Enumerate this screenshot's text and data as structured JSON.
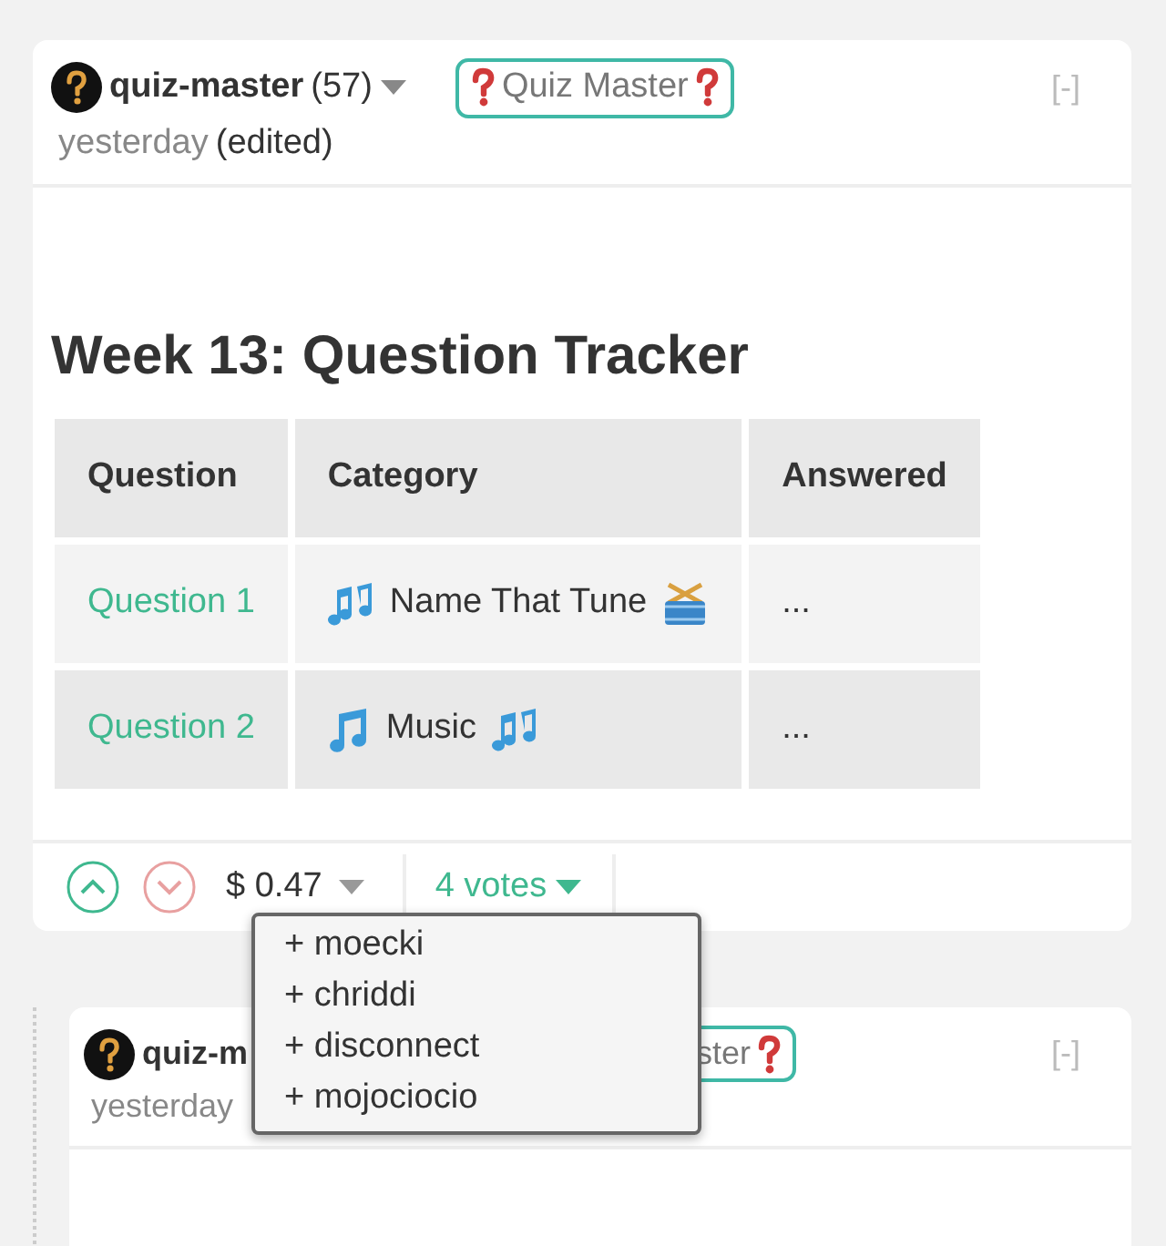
{
  "posts": [
    {
      "author": "quiz-master",
      "reputation": "(57)",
      "badge": "Quiz Master",
      "time": "yesterday",
      "edited": "(edited)",
      "collapse": "[-]",
      "title": "Week 13: Question Tracker",
      "table": {
        "columns": [
          "Question",
          "Category",
          "Answered"
        ],
        "rows": [
          {
            "question": "Question 1",
            "category": [
              {
                "kind": "notes"
              },
              {
                "kind": "text",
                "text": "Name That Tune"
              },
              {
                "kind": "drum"
              }
            ],
            "answered": "..."
          },
          {
            "question": "Question 2",
            "category": [
              {
                "kind": "note"
              },
              {
                "kind": "text",
                "text": "Music"
              },
              {
                "kind": "notes"
              }
            ],
            "answered": "..."
          }
        ]
      },
      "footer": {
        "payout": "$ 0.47",
        "votes": "4 votes",
        "expanded": true,
        "voters": [
          "+ moecki",
          "+ chriddi",
          "+ disconnect",
          "+ mojociocio"
        ]
      }
    },
    {
      "author": "quiz-m",
      "badge": "ster",
      "time": "yesterday",
      "collapse": "[-]"
    }
  ]
}
